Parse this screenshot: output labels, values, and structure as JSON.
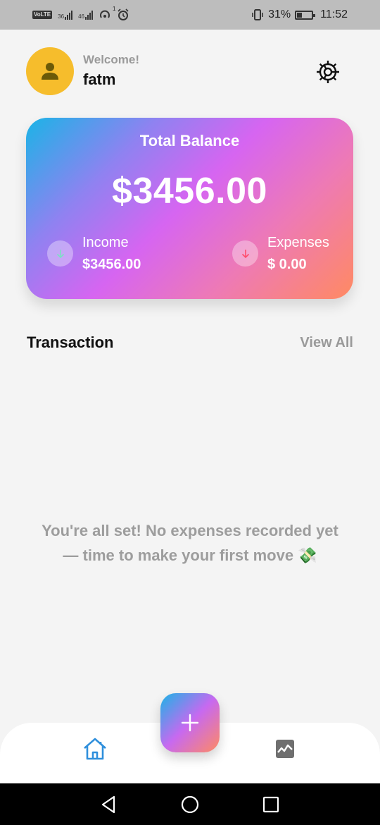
{
  "status_bar": {
    "network_labels": [
      "VoLTE",
      "36",
      "46"
    ],
    "alarm_superscript": "1",
    "battery": "31%",
    "time": "11:52"
  },
  "header": {
    "welcome": "Welcome!",
    "username": "fatm",
    "avatar_icon": "person-icon",
    "settings_icon": "gear-icon"
  },
  "balance_card": {
    "title": "Total Balance",
    "amount": "$3456.00",
    "income_label": "Income",
    "income_value": "$3456.00",
    "expenses_label": "Expenses",
    "expenses_value": "$ 0.00",
    "income_icon_color": "#7be0c4",
    "expenses_icon_color": "#ff4d6d"
  },
  "transactions": {
    "title": "Transaction",
    "view_all": "View All",
    "empty_line1": "You're all set! No expenses recorded yet",
    "empty_line2": "— time to make your first move 💸"
  },
  "bottom_nav": {
    "home_icon": "home-icon",
    "add_icon": "plus-icon",
    "stats_icon": "chart-icon",
    "accent": "#2f8fdc"
  },
  "system_nav": {
    "back_icon": "back-triangle-icon",
    "home_icon": "home-circle-icon",
    "recents_icon": "recents-square-icon"
  }
}
